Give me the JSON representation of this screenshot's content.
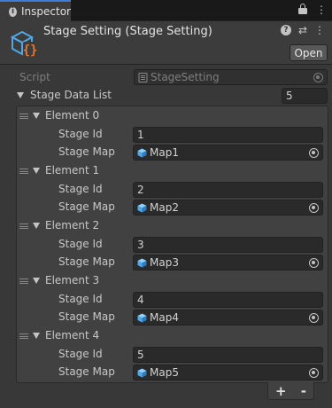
{
  "window": {
    "tab_title": "Inspector"
  },
  "component": {
    "title": "Stage Setting (Stage Setting)",
    "open_label": "Open"
  },
  "script_field": {
    "label": "Script",
    "value": "StageSetting"
  },
  "list": {
    "label": "Stage Data List",
    "count": "5",
    "elements": [
      {
        "title": "Element 0",
        "id_label": "Stage Id",
        "id_value": "1",
        "map_label": "Stage Map",
        "map_value": "Map1"
      },
      {
        "title": "Element 1",
        "id_label": "Stage Id",
        "id_value": "2",
        "map_label": "Stage Map",
        "map_value": "Map2"
      },
      {
        "title": "Element 2",
        "id_label": "Stage Id",
        "id_value": "3",
        "map_label": "Stage Map",
        "map_value": "Map3"
      },
      {
        "title": "Element 3",
        "id_label": "Stage Id",
        "id_value": "4",
        "map_label": "Stage Map",
        "map_value": "Map4"
      },
      {
        "title": "Element 4",
        "id_label": "Stage Id",
        "id_value": "5",
        "map_label": "Stage Map",
        "map_value": "Map5"
      }
    ],
    "add_label": "+",
    "remove_label": "-"
  },
  "colors": {
    "tab_accent": "#3a7fd6",
    "cube_blue": "#4fa8e8",
    "script_orange": "#e8762c"
  },
  "icons": [
    "info-icon",
    "lock-icon",
    "menu-icon",
    "help-icon",
    "settings-icon",
    "script-icon",
    "cube-icon",
    "object-picker-icon",
    "foldout-arrow-icon",
    "drag-handle-icon"
  ]
}
